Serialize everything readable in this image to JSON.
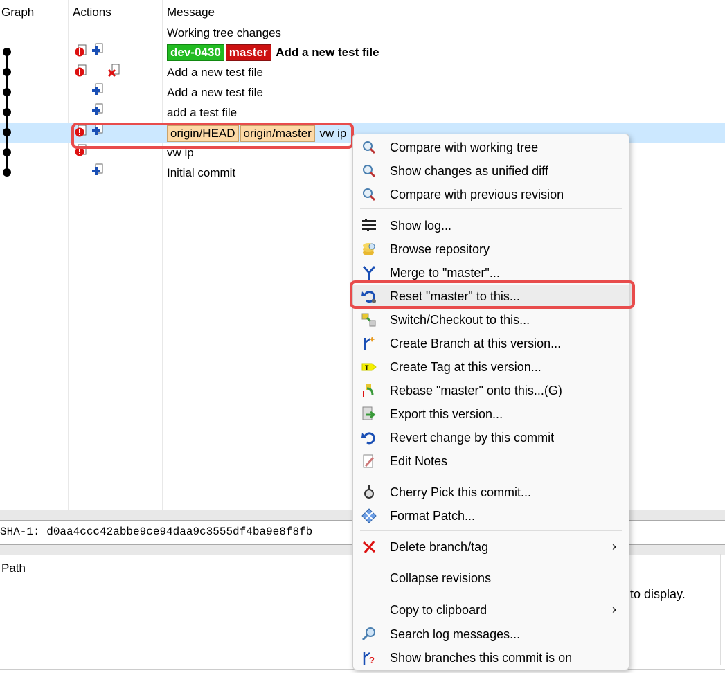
{
  "columns": {
    "graph": "Graph",
    "actions": "Actions",
    "message": "Message"
  },
  "rows": [
    {
      "message": "Working tree changes",
      "bold": false
    },
    {
      "refs": [
        {
          "label": "dev-0430",
          "style": "green"
        },
        {
          "label": "master",
          "style": "red"
        }
      ],
      "message": "Add a new test file",
      "bold": true
    },
    {
      "message": "Add a new test file",
      "bold": false
    },
    {
      "message": "Add a new test file",
      "bold": false
    },
    {
      "message": "add a test file",
      "bold": false
    },
    {
      "refs": [
        {
          "label": "origin/HEAD",
          "style": "orange"
        },
        {
          "label": "origin/master",
          "style": "orange"
        }
      ],
      "message": "vw ip",
      "bold": false,
      "selected": true
    },
    {
      "message": "vw ip",
      "bold": false
    },
    {
      "message": "Initial commit",
      "bold": false
    }
  ],
  "sha_line": "SHA-1: d0aa4ccc42abbe9ce94daa9c3555df4ba9e8f8fb",
  "files_panel": {
    "path_header": "Path",
    "empty_text": "to display."
  },
  "context_menu": [
    {
      "label": "Compare with working tree",
      "icon": "magnifier-icon"
    },
    {
      "label": "Show changes as unified diff",
      "icon": "magnifier-icon"
    },
    {
      "label": "Compare with previous revision",
      "icon": "magnifier-icon"
    },
    {
      "label": "Show log...",
      "icon": "log-icon"
    },
    {
      "label": "Browse repository",
      "icon": "repo-icon"
    },
    {
      "label": "Merge to \"master\"...",
      "icon": "merge-icon"
    },
    {
      "label": "Reset \"master\" to this...",
      "icon": "reset-icon"
    },
    {
      "label": "Switch/Checkout to this...",
      "icon": "switch-icon"
    },
    {
      "label": "Create Branch at this version...",
      "icon": "branch-icon"
    },
    {
      "label": "Create Tag at this version...",
      "icon": "tag-icon"
    },
    {
      "label": "Rebase \"master\" onto this...(G)",
      "icon": "rebase-icon"
    },
    {
      "label": "Export this version...",
      "icon": "export-icon"
    },
    {
      "label": "Revert change by this commit",
      "icon": "revert-icon"
    },
    {
      "label": "Edit Notes",
      "icon": "notes-icon"
    },
    {
      "label": "Cherry Pick this commit...",
      "icon": "cherry-pick-icon"
    },
    {
      "label": "Format Patch...",
      "icon": "patch-icon"
    },
    {
      "label": "Delete branch/tag",
      "icon": "delete-icon",
      "submenu": true
    },
    {
      "label": "Collapse revisions",
      "icon": "",
      "submenu": false
    },
    {
      "label": "Copy to clipboard",
      "icon": "",
      "submenu": true
    },
    {
      "label": "Search log messages...",
      "icon": "search-icon"
    },
    {
      "label": "Show branches this commit is on",
      "icon": "branches-icon"
    }
  ],
  "colors": {
    "selected_row": "#cce8ff",
    "highlight": "#e84c4c",
    "branch_local": "#22bb22",
    "branch_current": "#cc1111",
    "remote": "#fdd9a6"
  }
}
